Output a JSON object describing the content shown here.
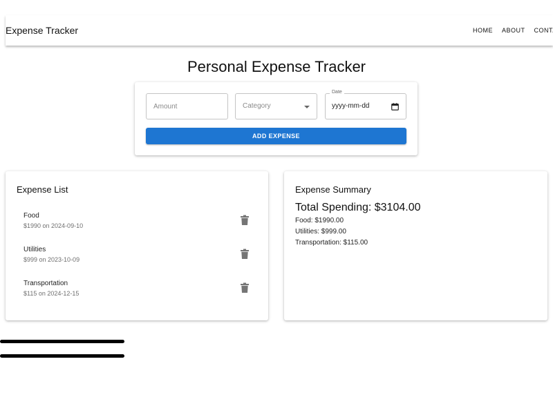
{
  "header": {
    "brand": "Expense Tracker",
    "nav": [
      "HOME",
      "ABOUT",
      "CONTACT"
    ]
  },
  "page_title": "Personal Expense Tracker",
  "form": {
    "amount_placeholder": "Amount",
    "category_value": "Category",
    "date_label": "Date",
    "date_value": "yyyy-mm-dd",
    "add_label": "ADD EXPENSE"
  },
  "expense_list": {
    "title": "Expense List",
    "items": [
      {
        "name": "Food",
        "detail": "$1990 on 2024-09-10"
      },
      {
        "name": "Utilities",
        "detail": "$999 on 2023-10-09"
      },
      {
        "name": "Transportation",
        "detail": "$115 on 2024-12-15"
      }
    ]
  },
  "summary": {
    "title": "Expense Summary",
    "total": "Total Spending: $3104.00",
    "lines": [
      "Food: $1990.00",
      "Utilities: $999.00",
      "Transportation: $115.00"
    ]
  },
  "icons": {
    "delete": "trash-icon",
    "calendar": "calendar-icon",
    "dropdown": "chevron-down-icon"
  },
  "colors": {
    "primary": "#1e76d2",
    "icon": "#757575"
  }
}
